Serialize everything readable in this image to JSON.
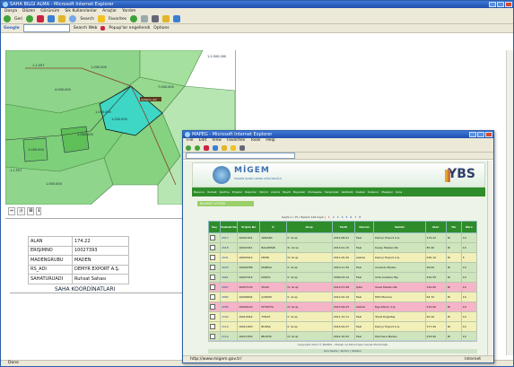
{
  "colors": {
    "accent": "#1f4fae",
    "ymbs_green": "#2f8c2a",
    "row_pink": "#f6b4c8",
    "row_yellow": "#f2f0b8",
    "row_green": "#cfe5bd",
    "map_fill": "#7fd07a",
    "highlight": "#3ed6c4"
  },
  "win1": {
    "title": "SAHA BILGI ALMA - Microsoft Internet Explorer",
    "menu": [
      "Dosya",
      "Düzen",
      "Görünüm",
      "Sık Kullanılanlar",
      "Araçlar",
      "Yardım"
    ],
    "toolbar": {
      "back": "Geri",
      "search": "Search",
      "favorites": "Favorites"
    },
    "google_label": "Google",
    "google_links": [
      "Search Web",
      "Popup'lar engellendi",
      "Options"
    ],
    "map_labels": [
      "1.1.057",
      "1.000.000",
      "1.2.000.000",
      "7.000.000",
      "4.000.000",
      "1.000.000",
      "1.000.000",
      "1.000.000",
      "1.000.000",
      "1.1.557",
      "1.000.000"
    ],
    "map_tag": "Sahanın adı",
    "map_tools": [
      "⇔",
      "Ⓟ",
      "⊠",
      "ℹ"
    ],
    "info_rows": [
      {
        "k": "ALAN",
        "v": "174.22"
      },
      {
        "k": "ERIŞIMNO",
        "v": "10027393"
      },
      {
        "k": "MADENGRUBU",
        "v": "MADEN"
      },
      {
        "k": "RS_ADI",
        "v": "DEMYR EXPORT A.Ş."
      },
      {
        "k": "SAHATURUADI",
        "v": "Ruhsat Sahası"
      }
    ],
    "bottom_label": "SAHA KOORDİNATLARI",
    "status": "Done"
  },
  "win2": {
    "title": "MAPEG - Microsoft Internet Explorer",
    "menu": [
      "File",
      "Edit",
      "View",
      "Favorites",
      "Tools",
      "Help"
    ],
    "logo_text": "MİGEM",
    "logo_sub": "MADEN İŞLERİ GENEL MÜDÜRLÜĞÜ",
    "brand": "YBS",
    "nav": [
      "Başvuru",
      "Ruhsat",
      "İşletme",
      "Projeler",
      "Raporlar",
      "Yatırım",
      "Arama",
      "Teşvik",
      "Beyanlar",
      "Muhasebe",
      "Yazışmalar",
      "İstatistik",
      "Destek",
      "Kullanıcı",
      "Mesajlar",
      "Çıkış"
    ],
    "section_title": "RUHSAT LISTESI",
    "pager_text": "Sayfa 1 / 15 ( Toplam 142 kayıt )",
    "pages": [
      "1",
      "2",
      "3",
      "4",
      "5",
      "6",
      "7",
      "8"
    ],
    "columns": [
      "Seç",
      "Ruhsat No",
      "Erişim No",
      "İl",
      "Grup",
      "Tarih",
      "Durum",
      "Sahibi",
      "Alan",
      "Tür",
      "Süre"
    ],
    "rows": [
      {
        "c": [
          "",
          "2017",
          "10001001",
          "ANKARA",
          "II. Grup",
          "2012.08.01",
          "Faal",
          "Demyr Export A.Ş.",
          "174.22",
          "IR",
          "10"
        ],
        "bg": "green"
      },
      {
        "c": [
          "",
          "2018",
          "10002341",
          "BALIKESİR",
          "III. Grup",
          "2013.01.15",
          "Faal",
          "Kuzey Madencilik",
          "85.40",
          "IR",
          "10"
        ],
        "bg": "green"
      },
      {
        "c": [
          "",
          "2041",
          "10005012",
          "İZMİR",
          "IV. Grup",
          "2011.05.20",
          "Askıda",
          "Demyr Export A.Ş.",
          "230.10",
          "IR",
          "5"
        ],
        "bg": "yellow"
      },
      {
        "c": [
          "",
          "2043",
          "10006788",
          "MANİSA",
          "II. Grup",
          "2010.11.30",
          "Faal",
          "Anadolu Maden",
          "96.00",
          "IR",
          "10"
        ],
        "bg": "green"
      },
      {
        "c": [
          "",
          "2061",
          "10007014",
          "KONYA",
          "II. Grup",
          "2009.03.12",
          "Faal",
          "Orta Anadolu Taş",
          "310.55",
          "IR",
          "10"
        ],
        "bg": "green"
      },
      {
        "c": [
          "",
          "2067",
          "10007130",
          "SİVAS",
          "IV. Grup",
          "2014.07.08",
          "İptal",
          "Sivas Madencilik",
          "142.00",
          "IR",
          "10"
        ],
        "bg": "pink"
      },
      {
        "c": [
          "",
          "2082",
          "10008004",
          "ÇORUM",
          "II. Grup",
          "2012.02.19",
          "Faal",
          "Hitit Mermer",
          "64.70",
          "IR",
          "10"
        ],
        "bg": "yellow"
      },
      {
        "c": [
          "",
          "2095",
          "10009120",
          "KÜTAHYA",
          "IV. Grup",
          "2013.09.03",
          "Askıda",
          "Ege Kömür A.Ş.",
          "512.00",
          "IR",
          "10"
        ],
        "bg": "pink"
      },
      {
        "c": [
          "",
          "2102",
          "10010442",
          "TOKAT",
          "II. Grup",
          "2011.12.11",
          "Faal",
          "Tokat Doğaltaş",
          "90.10",
          "IR",
          "10"
        ],
        "bg": "yellow"
      },
      {
        "c": [
          "",
          "2110",
          "10011003",
          "BURSA",
          "II. Grup",
          "2015.04.27",
          "Faal",
          "Demyr Export A.Ş.",
          "177.45",
          "IR",
          "10"
        ],
        "bg": "yellow"
      },
      {
        "c": [
          "",
          "2114",
          "10011502",
          "BİLECİK",
          "IV. Grup",
          "2014.10.02",
          "Faal",
          "Marmara Maden",
          "233.90",
          "IR",
          "10"
        ],
        "bg": "green"
      }
    ],
    "footer": "Copyright 2013 © MAPEG - Maden ve Petrol İşleri Genel Müdürlüğü",
    "footer_links": "Ana Sayfa | Yardım | İletişim",
    "status": "http://www.migem.gov.tr/",
    "status_zone": "Internet"
  }
}
